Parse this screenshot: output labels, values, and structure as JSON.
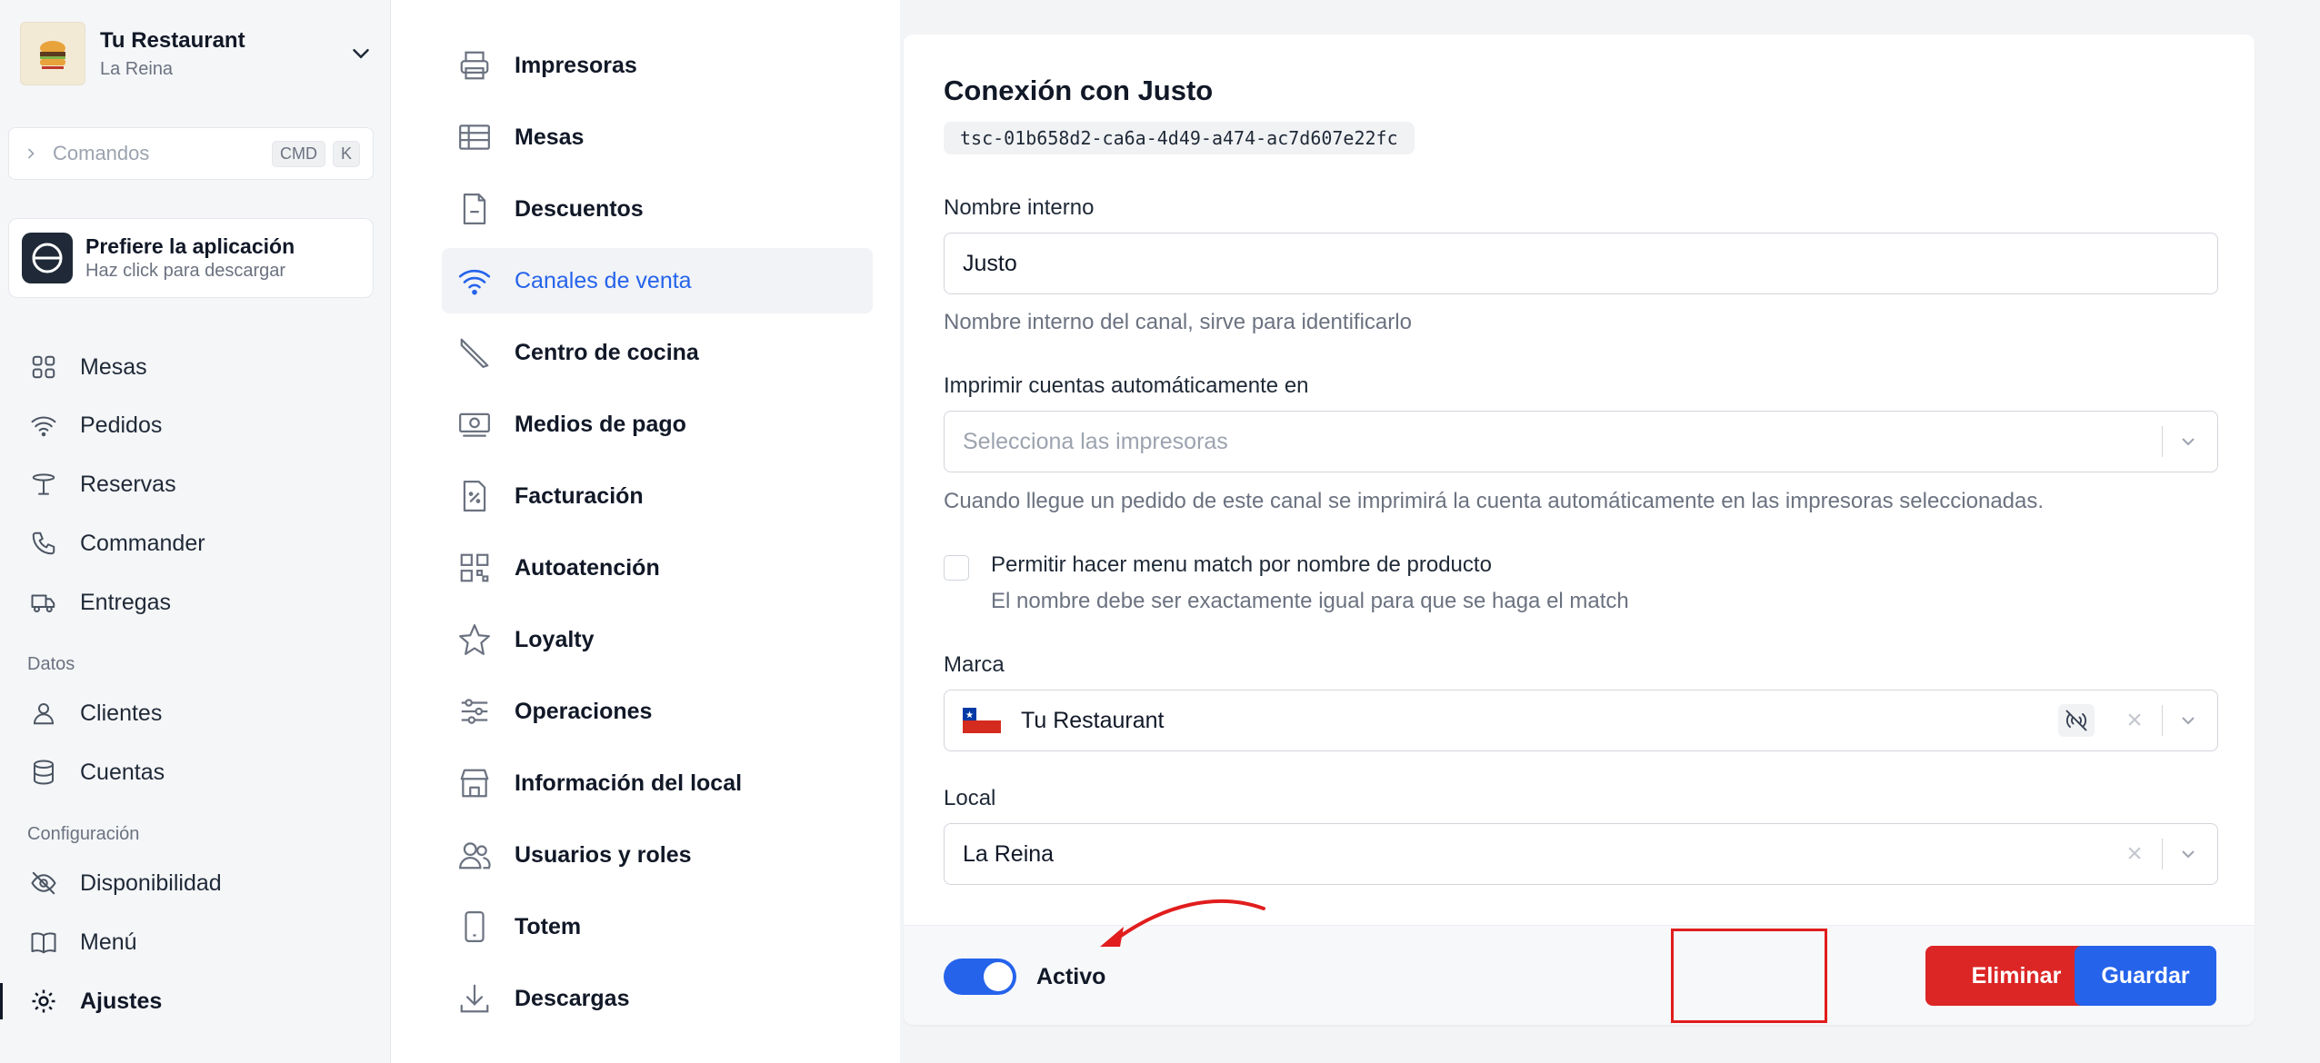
{
  "brand": {
    "name": "Tu Restaurant",
    "location": "La Reina"
  },
  "command_bar": {
    "placeholder": "Comandos",
    "key1": "CMD",
    "key2": "K"
  },
  "app_promo": {
    "title": "Prefiere la aplicación",
    "subtitle": "Haz click para descargar"
  },
  "sidebar": {
    "items": [
      {
        "label": "Mesas",
        "icon": "grid-icon"
      },
      {
        "label": "Pedidos",
        "icon": "wifi-icon"
      },
      {
        "label": "Reservas",
        "icon": "reservation-icon"
      },
      {
        "label": "Commander",
        "icon": "phone-icon"
      },
      {
        "label": "Entregas",
        "icon": "truck-icon"
      }
    ],
    "section_data": "Datos",
    "data_items": [
      {
        "label": "Clientes",
        "icon": "user-icon"
      },
      {
        "label": "Cuentas",
        "icon": "database-icon"
      }
    ],
    "section_config": "Configuración",
    "config_items": [
      {
        "label": "Disponibilidad",
        "icon": "eye-off-icon"
      },
      {
        "label": "Menú",
        "icon": "book-icon"
      },
      {
        "label": "Ajustes",
        "icon": "gear-icon"
      }
    ]
  },
  "settings_nav": [
    {
      "label": "Impresoras",
      "icon": "printer-icon"
    },
    {
      "label": "Mesas",
      "icon": "table-icon"
    },
    {
      "label": "Descuentos",
      "icon": "document-icon"
    },
    {
      "label": "Canales de venta",
      "icon": "wifi-icon",
      "active": true
    },
    {
      "label": "Centro de cocina",
      "icon": "knife-icon"
    },
    {
      "label": "Medios de pago",
      "icon": "money-icon"
    },
    {
      "label": "Facturación",
      "icon": "receipt-icon"
    },
    {
      "label": "Autoatención",
      "icon": "qr-icon"
    },
    {
      "label": "Loyalty",
      "icon": "star-icon"
    },
    {
      "label": "Operaciones",
      "icon": "sliders-icon"
    },
    {
      "label": "Información del local",
      "icon": "store-icon"
    },
    {
      "label": "Usuarios y roles",
      "icon": "users-icon"
    },
    {
      "label": "Totem",
      "icon": "tablet-icon"
    },
    {
      "label": "Descargas",
      "icon": "download-icon"
    }
  ],
  "form": {
    "title": "Conexión con Justo",
    "id": "tsc-01b658d2-ca6a-4d49-a474-ac7d607e22fc",
    "internal_name_label": "Nombre interno",
    "internal_name_value": "Justo",
    "internal_name_help": "Nombre interno del canal, sirve para identificarlo",
    "print_label": "Imprimir cuentas automáticamente en",
    "print_placeholder": "Selecciona las impresoras",
    "print_help": "Cuando llegue un pedido de este canal se imprimirá la cuenta automáticamente en las impresoras seleccionadas.",
    "menu_match_label": "Permitir hacer menu match por nombre de producto",
    "menu_match_help": "El nombre debe ser exactamente igual para que se haga el match",
    "brand_label": "Marca",
    "brand_value": "Tu Restaurant",
    "local_label": "Local",
    "local_value": "La Reina",
    "active_label": "Activo",
    "delete_label": "Eliminar",
    "save_label": "Guardar"
  },
  "colors": {
    "accent": "#2563eb",
    "danger": "#dc2626",
    "annotation": "#e11d1d"
  }
}
